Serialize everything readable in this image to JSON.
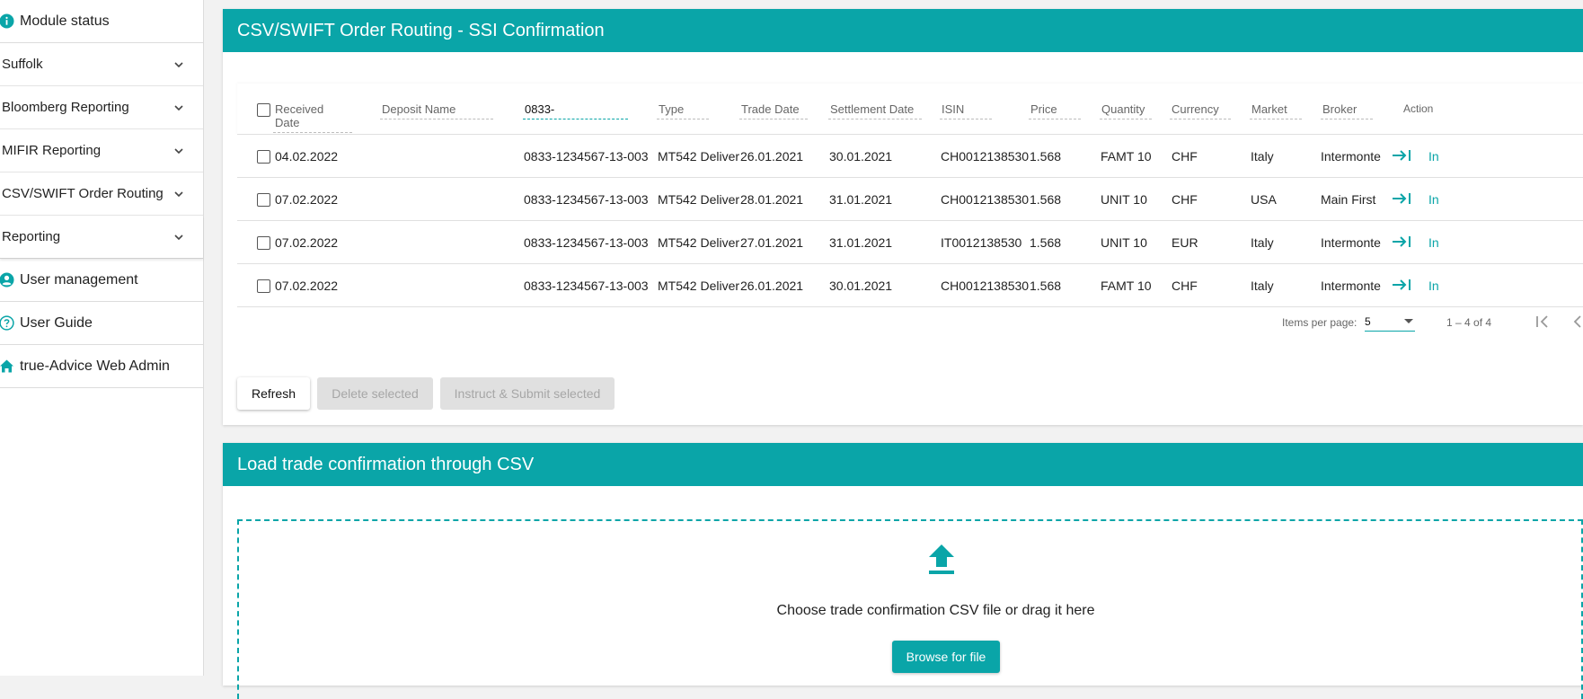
{
  "sidebar": {
    "top_items": [
      {
        "label": "Module status",
        "icon": "info-icon"
      }
    ],
    "expanders": [
      {
        "label": "Suffolk"
      },
      {
        "label": "Bloomberg Reporting"
      },
      {
        "label": "MIFIR Reporting"
      },
      {
        "label": "CSV/SWIFT Order Routing"
      },
      {
        "label": "Reporting"
      }
    ],
    "bottom_items": [
      {
        "label": "User management",
        "icon": "user-circle-icon"
      },
      {
        "label": "User Guide",
        "icon": "help-circle-icon"
      },
      {
        "label": "true-Advice Web Admin",
        "icon": "home-icon"
      }
    ]
  },
  "panel1": {
    "title": "CSV/SWIFT Order Routing - SSI Confirmation",
    "columns": {
      "received_date": "Received Date",
      "deposit_name": "Deposit Name",
      "deposit_filter_value": "0833-",
      "type": "Type",
      "trade_date": "Trade Date",
      "settlement_date": "Settlement Date",
      "isin": "ISIN",
      "price": "Price",
      "quantity": "Quantity",
      "currency": "Currency",
      "market": "Market",
      "broker": "Broker",
      "action": "Action"
    },
    "rows": [
      {
        "received": "04.02.2022",
        "deposit": "0833-1234567-13-003",
        "type": "MT542 Deliver",
        "trade": "26.01.2021",
        "settlement": "30.01.2021",
        "isin": "CH0012138530",
        "price": "1.568",
        "quantity": "FAMT 10",
        "currency": "CHF",
        "market": "Italy",
        "broker": "Intermonte",
        "more": "In"
      },
      {
        "received": "07.02.2022",
        "deposit": "0833-1234567-13-003",
        "type": "MT542 Deliver",
        "trade": "28.01.2021",
        "settlement": "31.01.2021",
        "isin": "CH0012138530",
        "price": "1.568",
        "quantity": "UNIT 10",
        "currency": "CHF",
        "market": "USA",
        "broker": "Main First",
        "more": "In"
      },
      {
        "received": "07.02.2022",
        "deposit": "0833-1234567-13-003",
        "type": "MT542 Deliver",
        "trade": "27.01.2021",
        "settlement": "31.01.2021",
        "isin": "IT0012138530",
        "price": "1.568",
        "quantity": "UNIT 10",
        "currency": "EUR",
        "market": "Italy",
        "broker": "Intermonte",
        "more": "In"
      },
      {
        "received": "07.02.2022",
        "deposit": "0833-1234567-13-003",
        "type": "MT542 Deliver",
        "trade": "26.01.2021",
        "settlement": "30.01.2021",
        "isin": "CH0012138530",
        "price": "1.568",
        "quantity": "FAMT 10",
        "currency": "CHF",
        "market": "Italy",
        "broker": "Intermonte",
        "more": "In"
      }
    ],
    "paginator": {
      "items_per_page_label": "Items per page:",
      "page_size": "5",
      "range": "1 – 4 of 4"
    },
    "buttons": {
      "refresh": "Refresh",
      "delete": "Delete selected",
      "instruct": "Instruct & Submit selected"
    }
  },
  "panel2": {
    "title": "Load trade confirmation through CSV",
    "drop_text": "Choose trade confirmation CSV file or drag it here",
    "browse": "Browse for file"
  },
  "colors": {
    "accent": "#0aa5a8",
    "disabled_bg": "#e0e0e0",
    "disabled_text": "#a6a6a6"
  }
}
